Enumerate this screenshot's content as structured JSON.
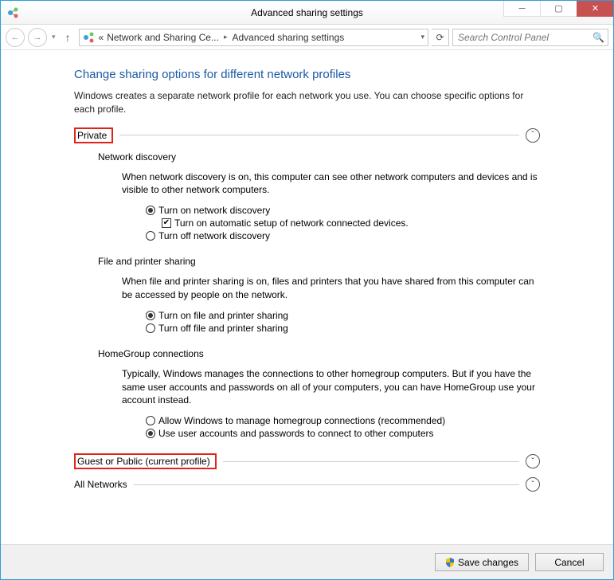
{
  "window": {
    "title": "Advanced sharing settings"
  },
  "breadcrumb": {
    "prefix": "«",
    "part1": "Network and Sharing Ce...",
    "part2": "Advanced sharing settings"
  },
  "search": {
    "placeholder": "Search Control Panel"
  },
  "heading": "Change sharing options for different network profiles",
  "description": "Windows creates a separate network profile for each network you use. You can choose specific options for each profile.",
  "profiles": {
    "private": {
      "label": "Private",
      "expanded": true
    },
    "guest": {
      "label": "Guest or Public (current profile)",
      "expanded": false
    },
    "all": {
      "label": "All Networks",
      "expanded": false
    }
  },
  "sections": {
    "network_discovery": {
      "title": "Network discovery",
      "desc": "When network discovery is on, this computer can see other network computers and devices and is visible to other network computers.",
      "on": "Turn on network discovery",
      "auto": "Turn on automatic setup of network connected devices.",
      "off": "Turn off network discovery",
      "selected": "on",
      "auto_checked": true
    },
    "file_printer": {
      "title": "File and printer sharing",
      "desc": "When file and printer sharing is on, files and printers that you have shared from this computer can be accessed by people on the network.",
      "on": "Turn on file and printer sharing",
      "off": "Turn off file and printer sharing",
      "selected": "on"
    },
    "homegroup": {
      "title": "HomeGroup connections",
      "desc": "Typically, Windows manages the connections to other homegroup computers. But if you have the same user accounts and passwords on all of your computers, you can have HomeGroup use your account instead.",
      "allow": "Allow Windows to manage homegroup connections (recommended)",
      "user": "Use user accounts and passwords to connect to other computers",
      "selected": "user"
    }
  },
  "footer": {
    "save": "Save changes",
    "cancel": "Cancel"
  }
}
